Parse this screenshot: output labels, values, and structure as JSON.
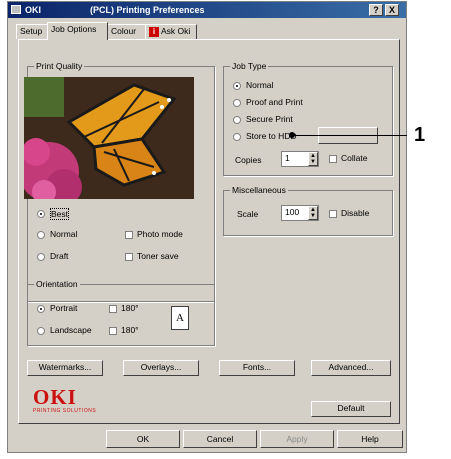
{
  "window": {
    "brand": "OKI",
    "title": "(PCL) Printing Preferences",
    "controls": [
      "?",
      "X"
    ]
  },
  "tabs": [
    {
      "label": "Setup"
    },
    {
      "label": "Job Options"
    },
    {
      "label": "Colour"
    },
    {
      "label": "Ask Oki"
    }
  ],
  "print_quality": {
    "group_label": "Print Quality",
    "options": {
      "best": "Best",
      "normal": "Normal",
      "draft": "Draft",
      "photo_mode": "Photo mode",
      "toner_save": "Toner save"
    }
  },
  "orientation": {
    "group_label": "Orientation",
    "portrait": "Portrait",
    "landscape": "Landscape",
    "rot_180_a": "180°",
    "rot_180_b": "180°",
    "page_glyph": "A"
  },
  "job_type": {
    "group_label": "Job Type",
    "normal": "Normal",
    "proof_and_print": "Proof and Print",
    "secure_print": "Secure Print",
    "store_to_hdd": "Store to HDD",
    "copies_label": "Copies",
    "copies_value": "1",
    "collate": "Collate"
  },
  "miscellaneous": {
    "group_label": "Miscellaneous",
    "scale_label": "Scale",
    "scale_value": "100",
    "disable": "Disable"
  },
  "buttons": {
    "watermarks": "Watermarks...",
    "overlays": "Overlays...",
    "fonts": "Fonts...",
    "advanced": "Advanced...",
    "default": "Default",
    "ok": "OK",
    "cancel": "Cancel",
    "apply": "Apply",
    "help": "Help"
  },
  "logo": {
    "text": "OKI",
    "tagline": "PRINTING SOLUTIONS",
    "color": "#cc1010"
  },
  "callout": {
    "number": "1"
  },
  "colors": {
    "titlebar": "#0a246a",
    "dialog_face": "#d4d0c8"
  }
}
